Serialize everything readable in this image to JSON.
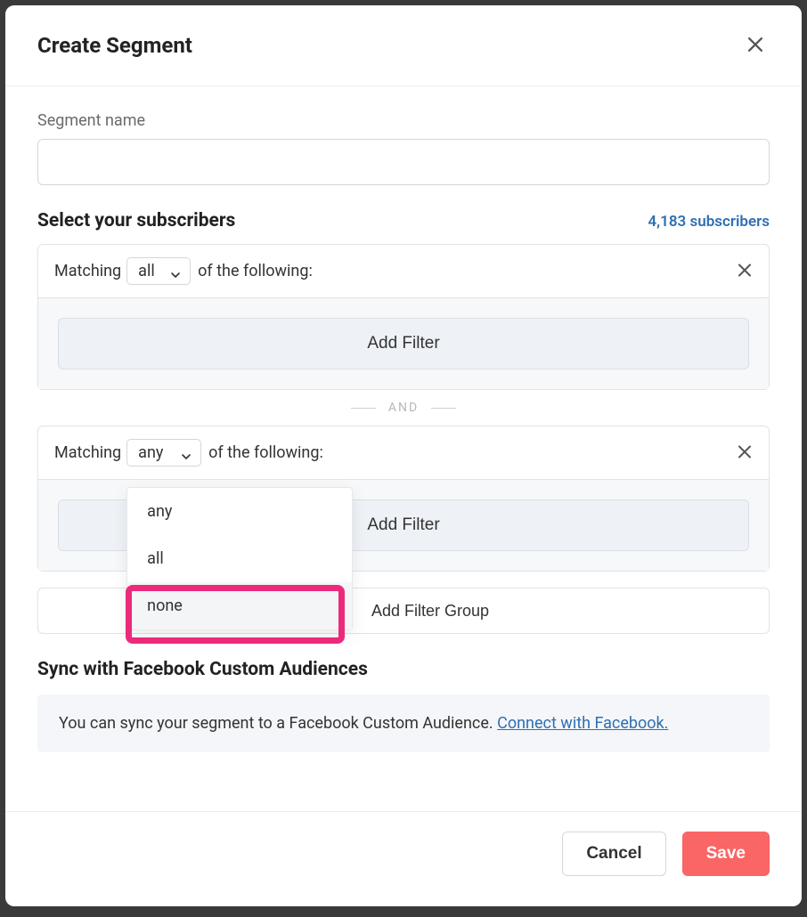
{
  "modal": {
    "title": "Create Segment",
    "segmentNameLabel": "Segment name",
    "segmentNameValue": ""
  },
  "subscribers": {
    "sectionTitle": "Select your subscribers",
    "countText": "4,183 subscribers"
  },
  "filterGroups": [
    {
      "matchingLabel": "Matching",
      "selected": "all",
      "followingLabel": "of the following:",
      "addFilterLabel": "Add Filter"
    },
    {
      "matchingLabel": "Matching",
      "selected": "any",
      "followingLabel": "of the following:",
      "addFilterLabel": "Add Filter"
    }
  ],
  "dropdown": {
    "options": [
      "any",
      "all",
      "none"
    ]
  },
  "divider": {
    "label": "AND"
  },
  "addGroup": {
    "label": "Add Filter Group"
  },
  "sync": {
    "title": "Sync with Facebook Custom Audiences",
    "text": "You can sync your segment to a Facebook Custom Audience. ",
    "linkText": "Connect with Facebook."
  },
  "footer": {
    "cancel": "Cancel",
    "save": "Save"
  }
}
